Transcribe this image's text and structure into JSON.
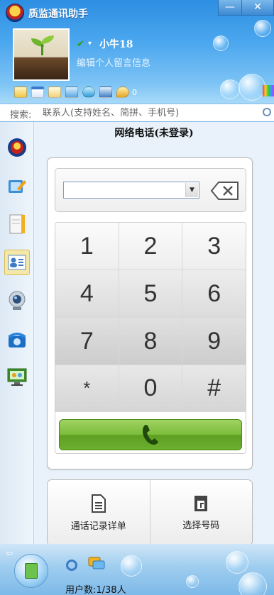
{
  "window": {
    "title": "质监通讯助手",
    "minimize_label": "—",
    "close_label": "✕"
  },
  "profile": {
    "status_icon": "✔",
    "status_caret": "▾",
    "nickname": "小牛18",
    "signature": "编辑个人留言信息"
  },
  "toolbar": {
    "icons": [
      "window-icon",
      "calendar-icon",
      "mail-icon",
      "folder-icon",
      "network-icon",
      "monitor-icon",
      "talk-icon"
    ],
    "notification_count": "0"
  },
  "search": {
    "prefix": "搜索:",
    "placeholder": "联系人(支持姓名、简拼、手机号)"
  },
  "sidebar": {
    "items": [
      "emblem",
      "edit",
      "notebook",
      "contacts",
      "webcam",
      "phone",
      "monitor"
    ],
    "active": "contacts"
  },
  "phone": {
    "panel_title": "网络电话(未登录)",
    "number_value": "",
    "keys": [
      [
        "1",
        "2",
        "3"
      ],
      [
        "4",
        "5",
        "6"
      ],
      [
        "7",
        "8",
        "9"
      ],
      [
        "*",
        "0",
        "#"
      ]
    ],
    "call_history_label": "通话记录详单",
    "select_number_label": "选择号码"
  },
  "footer": {
    "back_arrow": "⇦",
    "user_count": "用户数:1/38人"
  },
  "colors": {
    "header_blue": "#3f9be8",
    "call_green": "#7bbc3a",
    "active_sidebar": "#f5e7a8"
  }
}
